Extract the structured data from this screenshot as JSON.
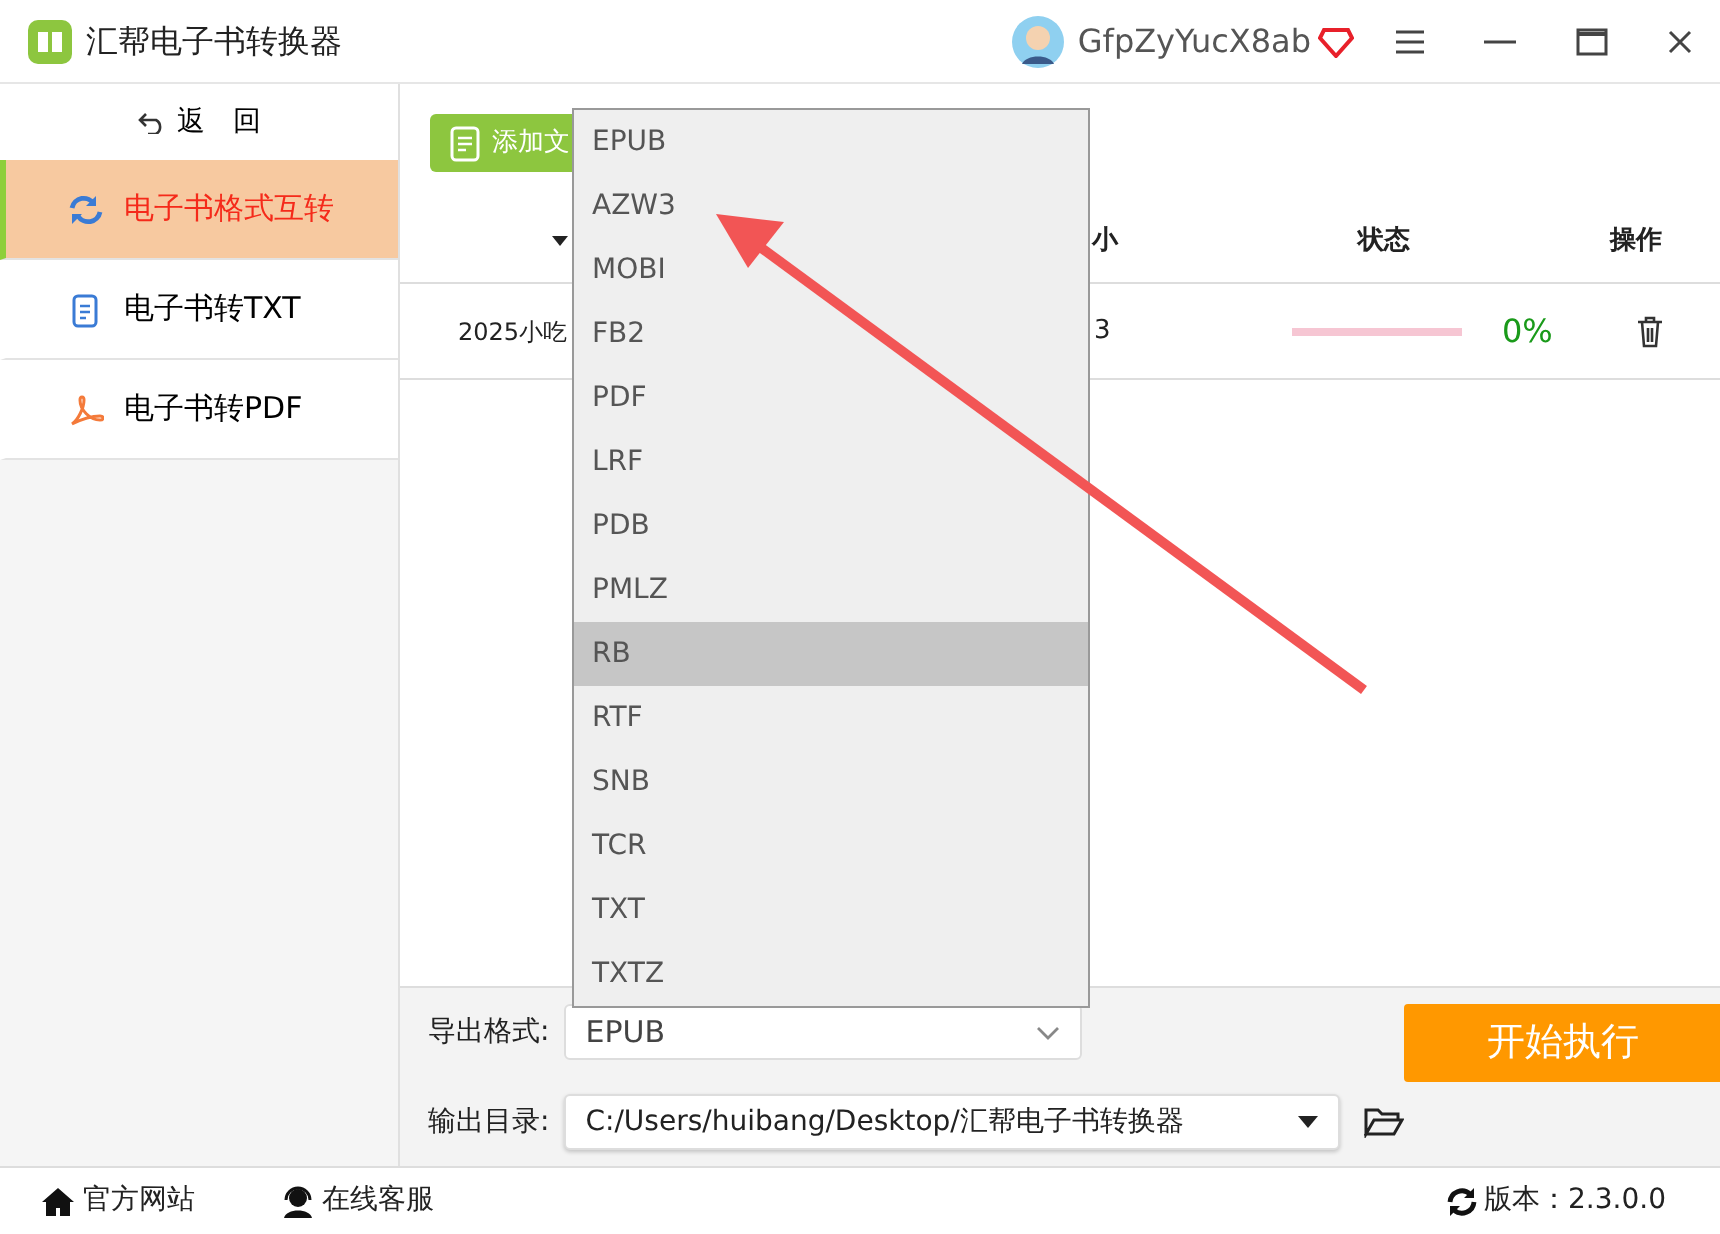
{
  "window": {
    "title": "汇帮电子书转换器",
    "username": "GfpZyYucX8ab"
  },
  "sidebar": {
    "back": "返　回",
    "items": [
      {
        "label": "电子书格式互转",
        "selected": true
      },
      {
        "label": "电子书转TXT",
        "selected": false
      },
      {
        "label": "电子书转PDF",
        "selected": false
      }
    ]
  },
  "toolbar": {
    "add_button": "添加文"
  },
  "table": {
    "columns": [
      "",
      "小",
      "状态",
      "操作"
    ],
    "rows": [
      {
        "name": "2025小吃",
        "size": "3",
        "level": 0,
        "percent": "0%"
      }
    ]
  },
  "format_dropdown": {
    "options": [
      {
        "label": "EPUB",
        "selected": false
      },
      {
        "label": "AZW3",
        "selected": false
      },
      {
        "label": "MOBI",
        "selected": false
      },
      {
        "label": "FB2",
        "selected": false
      },
      {
        "label": "PDF",
        "selected": false
      },
      {
        "label": "LRF",
        "selected": false
      },
      {
        "label": "PDB",
        "selected": false
      },
      {
        "label": "PMLZ",
        "selected": false
      },
      {
        "label": "RB",
        "selected": true
      },
      {
        "label": "RTF",
        "selected": false
      },
      {
        "label": "SNB",
        "selected": false
      },
      {
        "label": "TCR",
        "selected": false
      },
      {
        "label": "TXT",
        "selected": false
      },
      {
        "label": "TXTZ",
        "selected": false
      }
    ]
  },
  "export": {
    "format_label": "导出格式:",
    "format_value": "EPUB",
    "dir_label": "输出目录:",
    "dir_value": "C:/Users/huibang/Desktop/汇帮电子书转换器",
    "start_button": "开始执行"
  },
  "status_bar": {
    "website": "官方网站",
    "support": "在线客服",
    "version": "版本：2.3.0.0"
  }
}
